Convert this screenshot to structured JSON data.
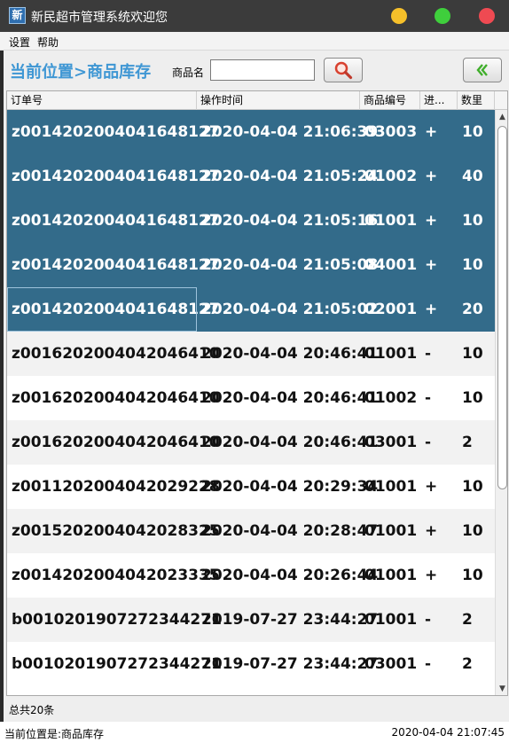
{
  "window": {
    "icon_char": "新",
    "title": "新民超市管理系统欢迎您",
    "btn_min_color": "#f6c02a",
    "btn_max_color": "#3fcf3c",
    "btn_close_color": "#ef4a52"
  },
  "menu": {
    "settings": "设置",
    "help": "帮助"
  },
  "toolbar": {
    "breadcrumb": "当前位置>商品库存",
    "search_label": "商品名",
    "search_value": "",
    "search_placeholder": "",
    "search_icon": "magnifier-icon",
    "back_icon": "double-chevron-left-icon"
  },
  "table": {
    "columns": [
      "订单号",
      "操作时间",
      "商品编号",
      "进...",
      "数里"
    ],
    "rows": [
      {
        "order": "z0014202004041648127",
        "time": "2020-04-04 21:06:39",
        "code": "03003",
        "dir": "+",
        "qty": "10",
        "selected": true
      },
      {
        "order": "z0014202004041648127",
        "time": "2020-04-04 21:05:24",
        "code": "01002",
        "dir": "+",
        "qty": "40",
        "selected": true
      },
      {
        "order": "z0014202004041648127",
        "time": "2020-04-04 21:05:16",
        "code": "01001",
        "dir": "+",
        "qty": "10",
        "selected": true
      },
      {
        "order": "z0014202004041648127",
        "time": "2020-04-04 21:05:08",
        "code": "04001",
        "dir": "+",
        "qty": "10",
        "selected": true
      },
      {
        "order": "z0014202004041648127",
        "time": "2020-04-04 21:05:02",
        "code": "02001",
        "dir": "+",
        "qty": "20",
        "selected": true
      },
      {
        "order": "z0016202004042046410",
        "time": "2020-04-04 20:46:41",
        "code": "01001",
        "dir": "-",
        "qty": "10",
        "selected": false
      },
      {
        "order": "z0016202004042046410",
        "time": "2020-04-04 20:46:41",
        "code": "01002",
        "dir": "-",
        "qty": "10",
        "selected": false
      },
      {
        "order": "z0016202004042046410",
        "time": "2020-04-04 20:46:41",
        "code": "03001",
        "dir": "-",
        "qty": "2",
        "selected": false
      },
      {
        "order": "z0011202004042029228",
        "time": "2020-04-04 20:29:34",
        "code": "01001",
        "dir": "+",
        "qty": "10",
        "selected": false
      },
      {
        "order": "z0015202004042028325",
        "time": "2020-04-04 20:28:47",
        "code": "01001",
        "dir": "+",
        "qty": "10",
        "selected": false
      },
      {
        "order": "z0014202004042023335",
        "time": "2020-04-04 20:26:44",
        "code": "01001",
        "dir": "+",
        "qty": "10",
        "selected": false
      },
      {
        "order": "b0010201907272344271",
        "time": "2019-07-27 23:44:27",
        "code": "01001",
        "dir": "-",
        "qty": "2",
        "selected": false
      },
      {
        "order": "b0010201907272344271",
        "time": "2019-07-27 23:44:27",
        "code": "03001",
        "dir": "-",
        "qty": "2",
        "selected": false
      }
    ],
    "selected_color": "#336b8a"
  },
  "footer": {
    "total": "总共20条"
  },
  "status": {
    "location": "当前位置是:商品库存",
    "datetime": "2020-04-04 21:07:45"
  }
}
